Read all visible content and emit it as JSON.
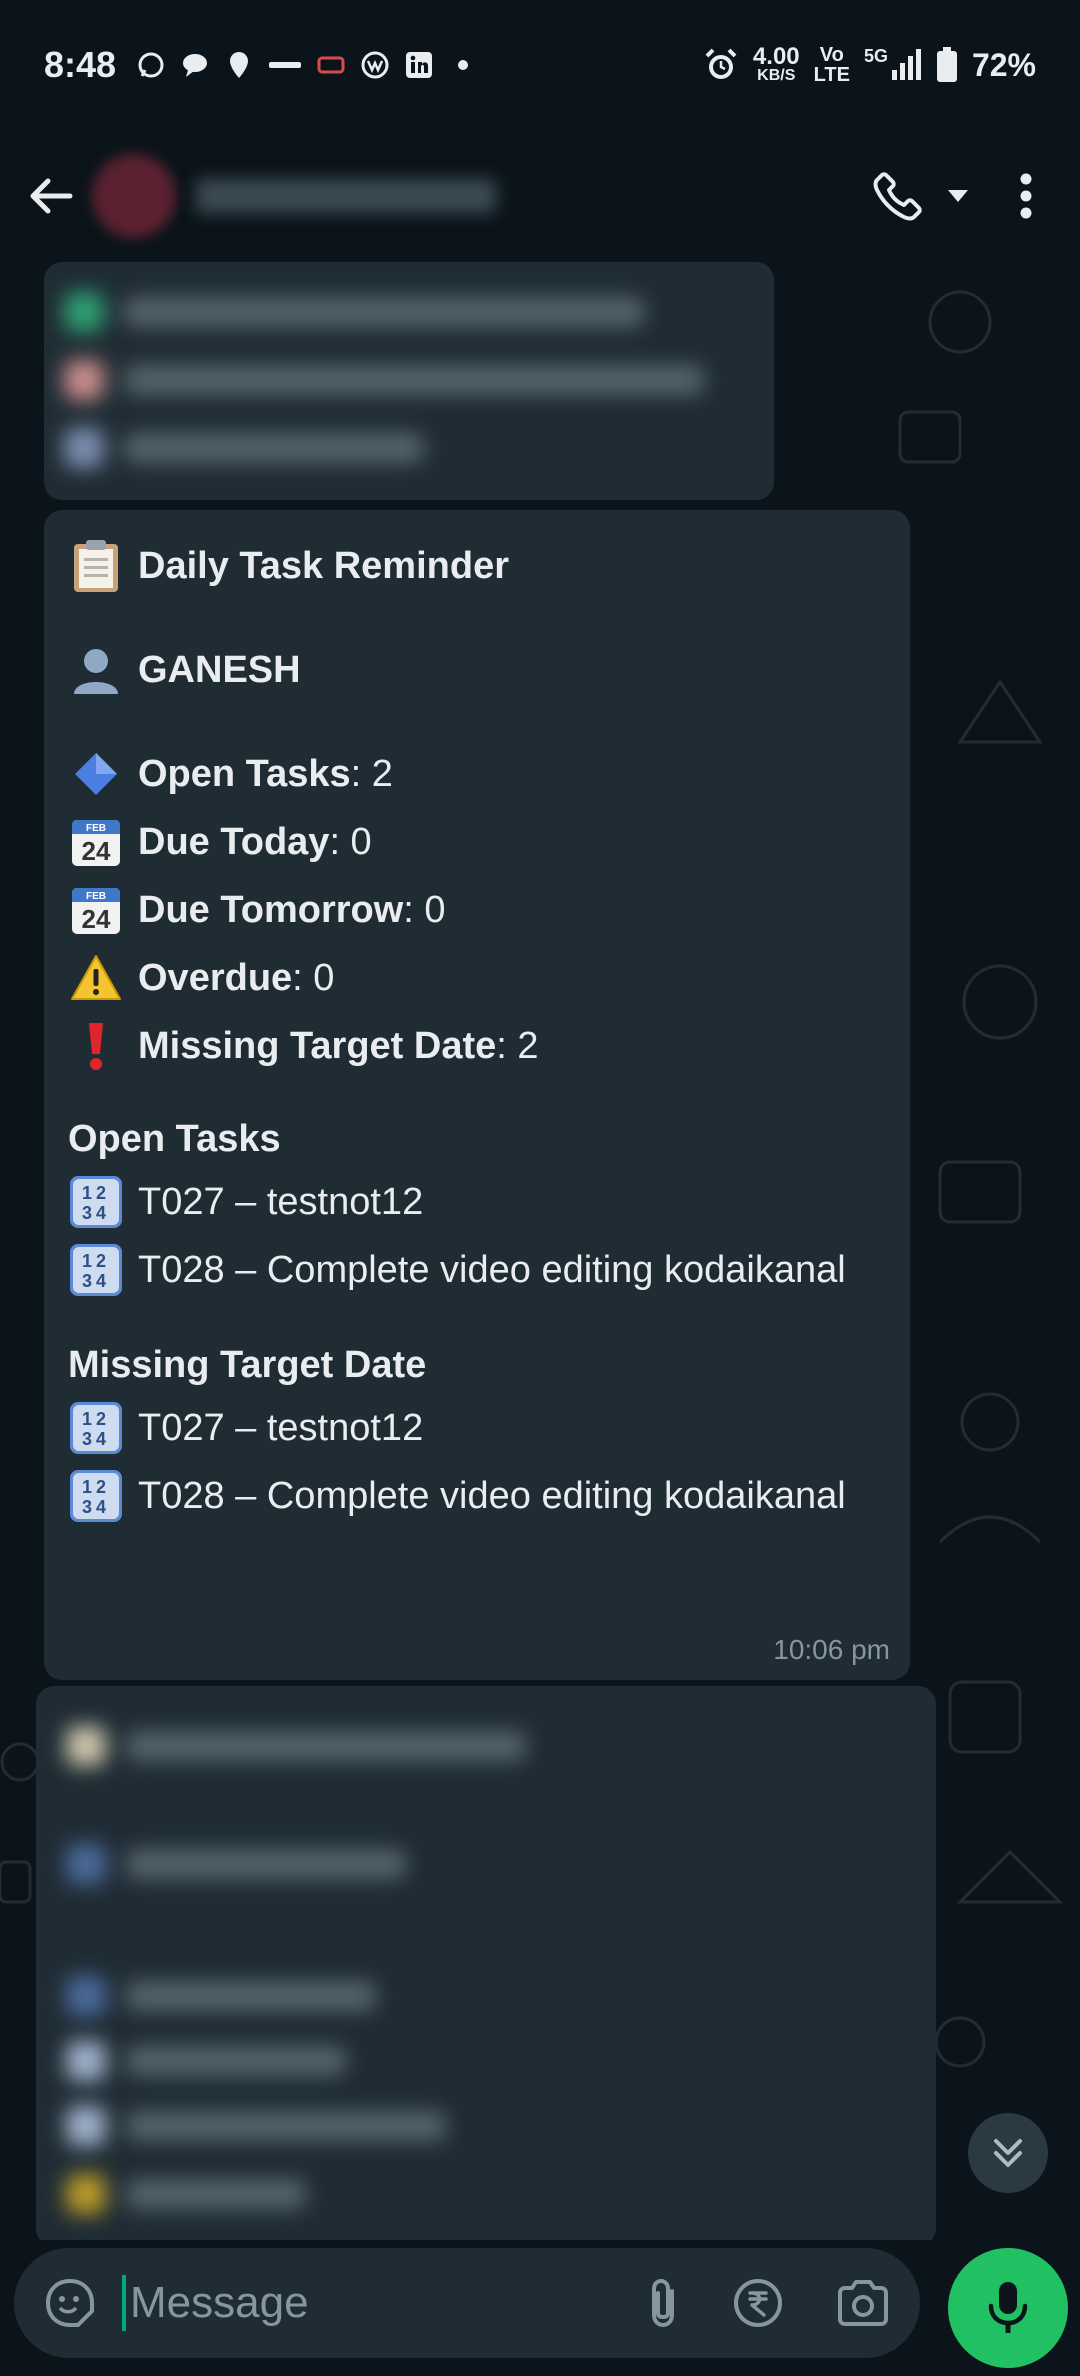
{
  "status_bar": {
    "time": "8:48",
    "speed_value": "4.00",
    "speed_unit": "KB/S",
    "volte_top": "Vo",
    "volte_bottom": "LTE",
    "network": "5G",
    "battery": "72%"
  },
  "header": {
    "icons": [
      "back-arrow-icon",
      "phone-icon",
      "chevron-down-icon",
      "more-vertical-icon"
    ]
  },
  "message": {
    "title": "Daily Task Reminder",
    "user": "GANESH",
    "stats": [
      {
        "emoji": "blue-diamond",
        "label": "Open Tasks",
        "value": ": 2"
      },
      {
        "emoji": "calendar",
        "label": "Due Today",
        "value": ": 0"
      },
      {
        "emoji": "calendar",
        "label": "Due Tomorrow",
        "value": ": 0"
      },
      {
        "emoji": "warning",
        "label": "Overdue",
        "value": ": 0"
      },
      {
        "emoji": "exclamation",
        "label": "Missing Target Date",
        "value": ": 2"
      }
    ],
    "open_tasks_title": "Open Tasks",
    "open_tasks": [
      "T027 – testnot12",
      "T028 – Complete video editing kodaikanal"
    ],
    "missing_title": "Missing Target Date",
    "missing_tasks": [
      "T027 – testnot12",
      "T028 – Complete video editing kodaikanal"
    ],
    "time": "10:06 pm",
    "calendar_month": "FEB",
    "calendar_day": "24",
    "numbers_top": "12",
    "numbers_bottom": "34"
  },
  "input": {
    "placeholder": "Message"
  },
  "colors": {
    "background": "#0b141a",
    "bubble": "#1f2c34",
    "accent_green": "#21c063",
    "muted_text": "#8696a0"
  }
}
